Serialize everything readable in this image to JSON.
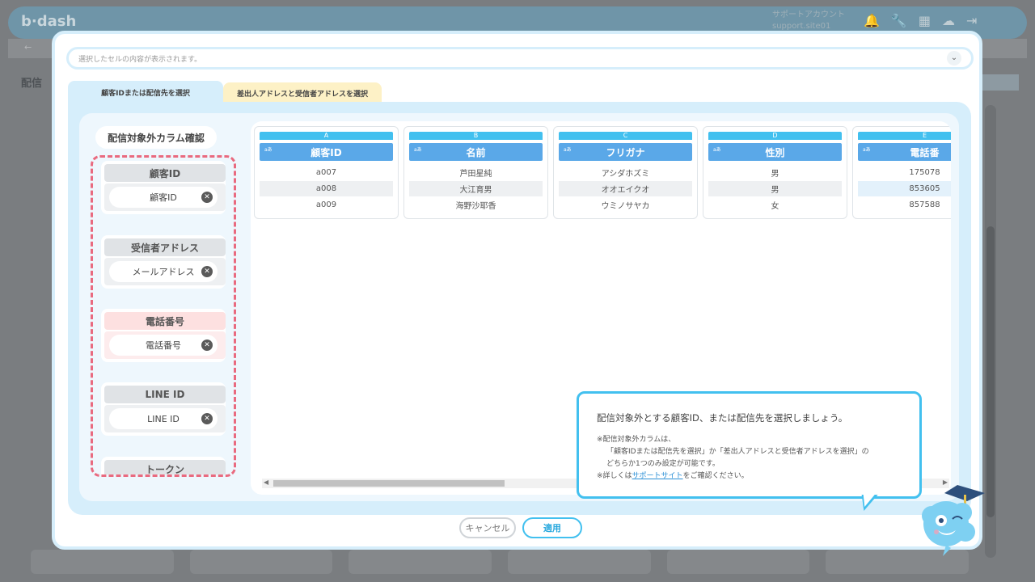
{
  "background": {
    "logo": "b·dash",
    "account_label": "サポートアカウント",
    "account_id": "support.site01",
    "page_title": "配信",
    "sub_bar_text": "←"
  },
  "modal": {
    "cell_display_placeholder": "選択したセルの内容が表示されます。",
    "tabs": [
      {
        "label": "顧客IDまたは配信先を選択",
        "active": true
      },
      {
        "label": "差出人アドレスと受信者アドレスを選択",
        "active": false
      }
    ],
    "left_title": "配信対象外カラム確認",
    "groups": [
      {
        "header": "顧客ID",
        "chip": "顧客ID"
      },
      {
        "header": "受信者アドレス",
        "chip": "メールアドレス"
      },
      {
        "header": "電話番号",
        "chip": "電話番号"
      },
      {
        "header": "LINE ID",
        "chip": "LINE ID"
      },
      {
        "header": "トークン",
        "chip": ""
      }
    ],
    "columns": [
      {
        "letter": "A",
        "type": "aあ",
        "name": "顧客ID",
        "rows": [
          "a007",
          "a008",
          "a009"
        ]
      },
      {
        "letter": "B",
        "type": "aあ",
        "name": "名前",
        "rows": [
          "芦田星純",
          "大江育男",
          "海野沙耶香"
        ]
      },
      {
        "letter": "C",
        "type": "aあ",
        "name": "フリガナ",
        "rows": [
          "アシダホズミ",
          "オオエイクオ",
          "ウミノサヤカ"
        ]
      },
      {
        "letter": "D",
        "type": "aあ",
        "name": "性別",
        "rows": [
          "男",
          "男",
          "女"
        ]
      },
      {
        "letter": "E",
        "type": "aあ",
        "name": "電話番",
        "rows": [
          "175078",
          "853605",
          "857588"
        ]
      }
    ],
    "cancel_label": "キャンセル",
    "apply_label": "適用"
  },
  "tooltip": {
    "title": "配信対象外とする顧客ID、または配信先を選択しましょう。",
    "note_line1": "※配信対象外カラムは、",
    "note_line2": "「顧客IDまたは配信先を選択」か「差出人アドレスと受信者アドレスを選択」の",
    "note_line3": "どちらか1つのみ設定が可能です。",
    "note_line4_pre": "※詳しくは",
    "note_link": "サポートサイト",
    "note_line4_post": "をご確認ください。"
  },
  "colors": {
    "accent": "#42c0ef",
    "header_blue": "#5aa8e8",
    "dashed_border": "#e96a7f",
    "panel_bg": "#d6eefb"
  }
}
